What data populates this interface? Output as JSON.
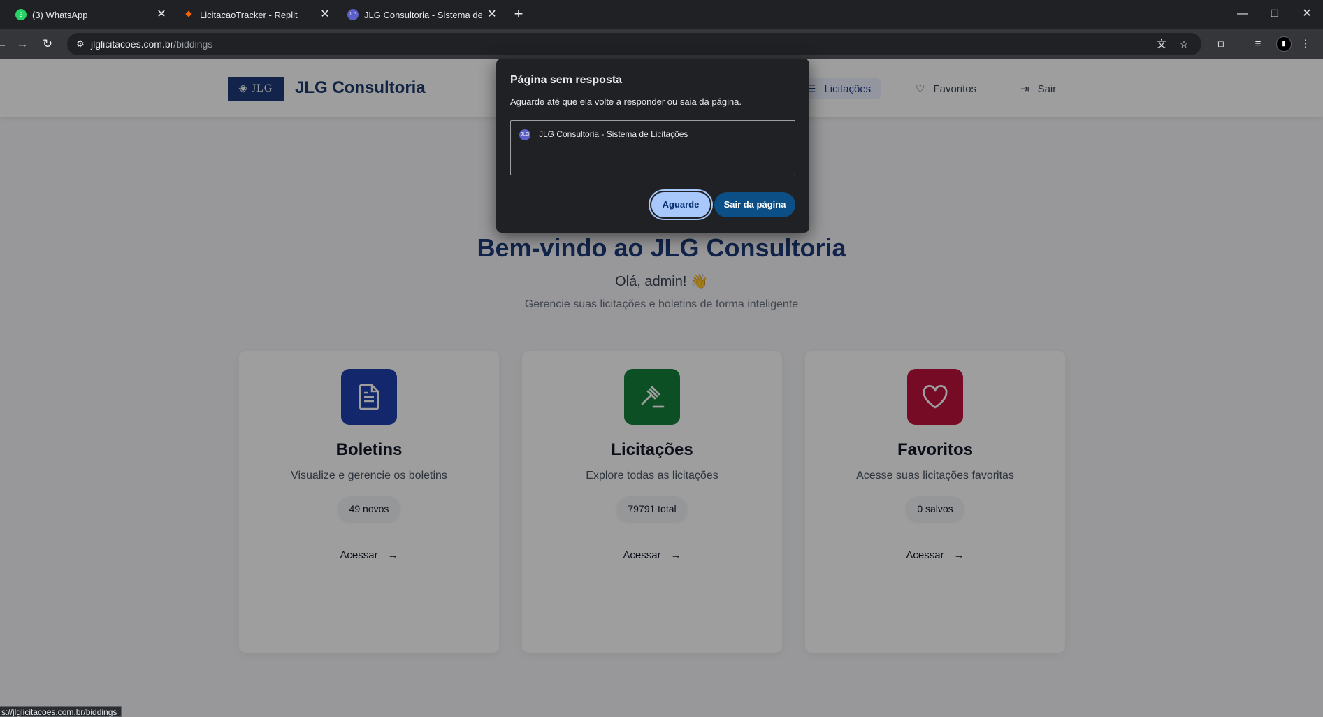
{
  "browser": {
    "tabs": [
      {
        "title": "(3) WhatsApp",
        "favicon": "whatsapp-icon",
        "badge": "3"
      },
      {
        "title": "LicitacaoTracker - Replit",
        "favicon": "replit-icon"
      },
      {
        "title": "JLG Consultoria - Sistema de Li",
        "favicon": "jlg-icon"
      }
    ],
    "url_host": "jlglicitacoes.com.br",
    "url_path": "/biddings",
    "status_url": "s://jlglicitacoes.com.br/biddings"
  },
  "header": {
    "logo_text": "JLG",
    "brand": "JLG Consultoria",
    "nav": {
      "licitacoes": "Licitações",
      "favoritos": "Favoritos",
      "sair": "Sair"
    }
  },
  "hero": {
    "title": "Bem-vindo ao JLG Consultoria",
    "greeting": "Olá, admin! 👋",
    "description": "Gerencie suas licitações e boletins de forma inteligente"
  },
  "cards": [
    {
      "title": "Boletins",
      "description": "Visualize e gerencie os boletins",
      "badge": "49 novos",
      "action": "Acessar",
      "color": "#1e40af",
      "icon": "document-icon"
    },
    {
      "title": "Licitações",
      "description": "Explore todas as licitações",
      "badge": "79791 total",
      "action": "Acessar",
      "color": "#15803d",
      "icon": "gavel-icon"
    },
    {
      "title": "Favoritos",
      "description": "Acesse suas licitações favoritas",
      "badge": "0 salvos",
      "action": "Acessar",
      "color": "#be123c",
      "icon": "heart-icon"
    }
  ],
  "dialog": {
    "title": "Página sem resposta",
    "message": "Aguarde até que ela volte a responder ou saia da página.",
    "page_item": "JLG Consultoria - Sistema de Licitações",
    "wait_label": "Aguarde",
    "leave_label": "Sair da página"
  }
}
